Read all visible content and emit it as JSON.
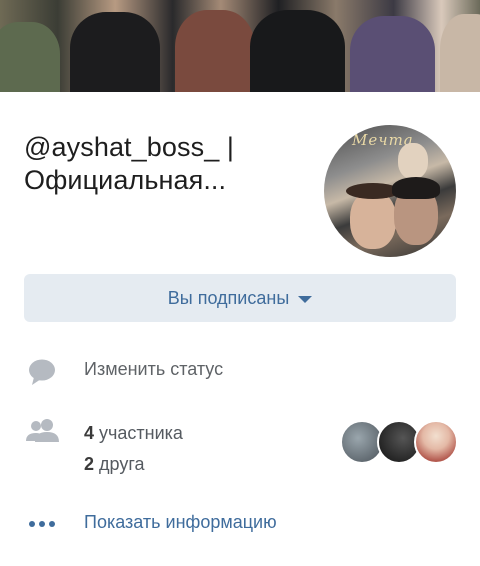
{
  "group": {
    "title_line1": "@ayshat_boss_  |",
    "title_line2": "Официальная...",
    "avatar_caption": "Мечта"
  },
  "subscribe_button": {
    "label": "Вы подписаны",
    "icon": "caret-down-icon"
  },
  "status": {
    "label": "Изменить статус",
    "icon": "speech-bubble-icon"
  },
  "members": {
    "icon": "people-icon",
    "count": "4",
    "count_label": "участника",
    "friends": "2",
    "friends_label": "друга"
  },
  "info": {
    "label": "Показать информацию",
    "icon": "more-dots-icon"
  },
  "colors": {
    "accent": "#3f6c9c",
    "button_bg": "#e5ebf1",
    "icon_gray": "#b5bac1"
  }
}
